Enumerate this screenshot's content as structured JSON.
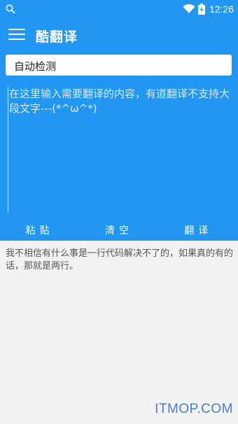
{
  "status_bar": {
    "time": "12:26",
    "icons": [
      "search-icon",
      "wifi-icon",
      "battery-charging-icon"
    ]
  },
  "app_bar": {
    "title": "酷翻译",
    "menu_icon": "hamburger-menu-icon"
  },
  "source_language": {
    "value": "自动检测"
  },
  "input": {
    "placeholder": "在这里输入需要翻译的内容，有道翻译不支持大段文字---(*^ω^*)"
  },
  "actions": {
    "paste_label": "粘贴",
    "clear_label": "清空",
    "translate_label": "翻译"
  },
  "result": {
    "text": "我不相信有什么事是一行代码解决不了的，如果真的有的话，那就是两行。"
  },
  "watermark": "ITMOP.COM",
  "colors": {
    "primary": "#2196f3",
    "background": "#f2f2f2",
    "watermark": "#4a7ec7"
  }
}
